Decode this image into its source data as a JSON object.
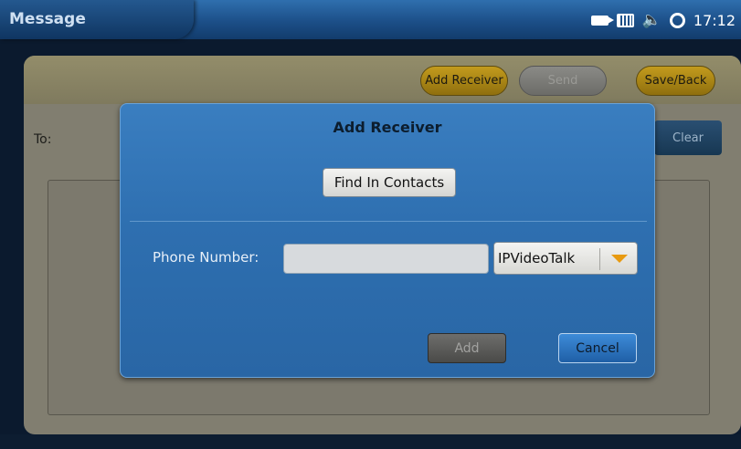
{
  "app": {
    "title": "Message"
  },
  "status_bar": {
    "icons": [
      "video-camera-icon",
      "keyboard-icon",
      "volume-icon",
      "sync-icon"
    ],
    "time": "17:12"
  },
  "toolbar": {
    "add_receiver_label": "Add Receiver",
    "send_label": "Send",
    "save_back_label": "Save/Back"
  },
  "compose": {
    "to_label": "To:",
    "clear_label": "Clear"
  },
  "dialog": {
    "title": "Add Receiver",
    "find_in_contacts_label": "Find In Contacts",
    "phone_number_label": "Phone Number:",
    "phone_number_value": "",
    "account_selected": "IPVideoTalk",
    "add_label": "Add",
    "cancel_label": "Cancel"
  },
  "colors": {
    "dialog_blue": "#2e6fb0",
    "gold_button": "#c39b1d",
    "dropdown_arrow": "#e89a10"
  }
}
